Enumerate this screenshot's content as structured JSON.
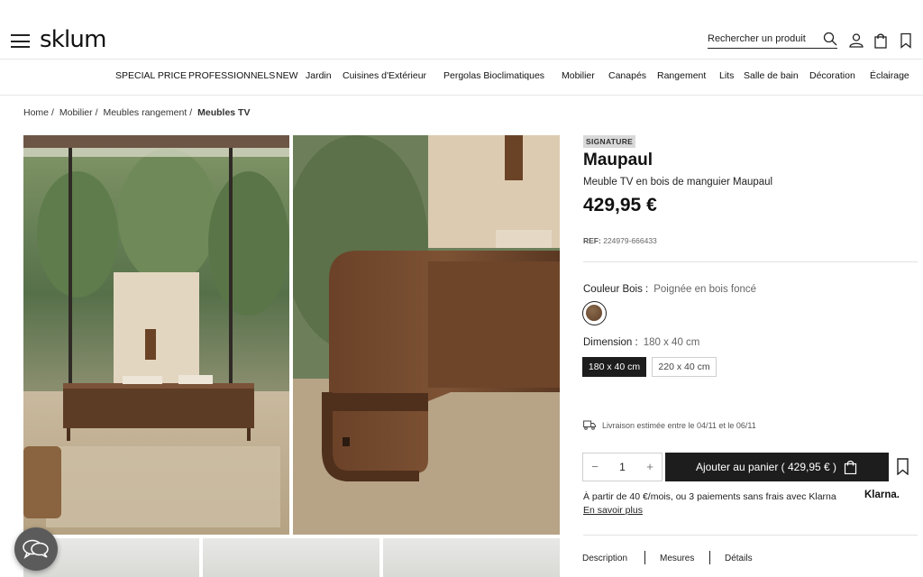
{
  "header": {
    "logo": "sklum",
    "search_label": "Rechercher un produit"
  },
  "nav": [
    "SPECIAL PRICE",
    "PROFESSIONNELS",
    "NEW",
    "Jardin",
    "Cuisines d'Extérieur",
    "Pergolas Bioclimatiques",
    "Mobilier",
    "Canapés",
    "Rangement",
    "Lits",
    "Salle de bain",
    "Décoration",
    "Éclairage"
  ],
  "breadcrumb": [
    "Home",
    "Mobilier",
    "Meubles rangement",
    "Meubles TV"
  ],
  "product": {
    "badge": "SIGNATURE",
    "name": "Maupaul",
    "subtitle": "Meuble TV en bois de manguier Maupaul",
    "price": "429,95 €",
    "ref_label": "REF:",
    "ref_value": "224979-666433",
    "color_label": "Couleur Bois :",
    "color_value": "Poignée en bois foncé",
    "dimension_label": "Dimension :",
    "dimension_value": "180 x 40 cm",
    "dimensions": [
      "180 x 40 cm",
      "220 x 40 cm"
    ],
    "delivery": "Livraison estimée entre le 04/11 et le 06/11",
    "quantity": "1",
    "qty_minus": "−",
    "qty_plus": "+",
    "add_to_cart": "Ajouter au panier ( 429,95 € )",
    "klarna_text": "À partir de 40 €/mois, ou 3 paiements sans frais avec Klarna",
    "klarna_logo": "Klarna.",
    "learn_more": "En savoir plus"
  },
  "tabs": [
    "Description",
    "Mesures",
    "Détails"
  ],
  "colors": {
    "accent_dark": "#1d1d1d",
    "badge_bg": "#d9d9d9",
    "wood": "#6b4a2f"
  }
}
